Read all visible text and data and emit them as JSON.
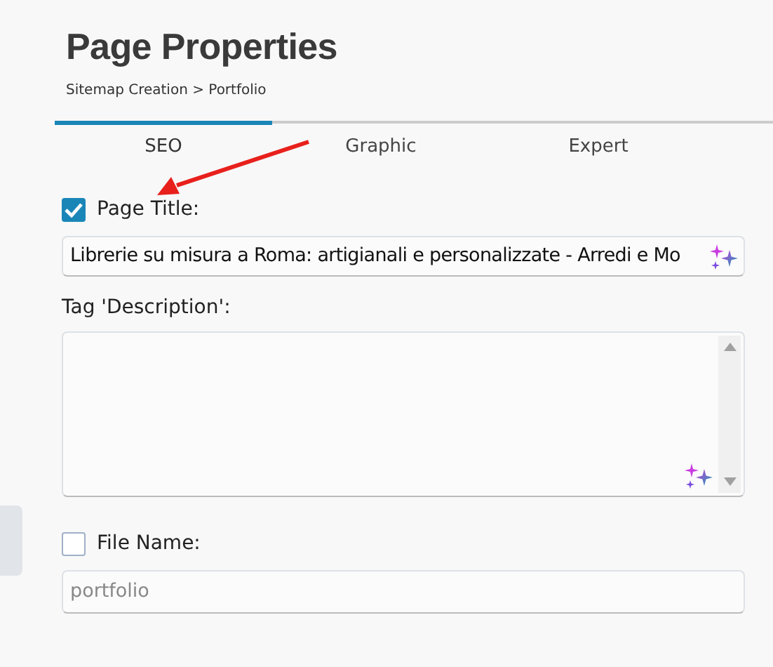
{
  "header": {
    "title": "Page Properties",
    "breadcrumb": "Sitemap Creation > Portfolio"
  },
  "tabs": [
    {
      "label": "SEO",
      "selected": true
    },
    {
      "label": "Graphic",
      "selected": false
    },
    {
      "label": "Expert",
      "selected": false
    }
  ],
  "page_title": {
    "label": "Page Title:",
    "checked": true,
    "value": "Librerie su misura a Roma: artigianali e personalizzate - Arredi e Mo"
  },
  "description": {
    "label": "Tag 'Description':"
  },
  "file_name": {
    "label": "File Name:",
    "checked": false,
    "value": "portfolio",
    "disabled": true
  }
}
